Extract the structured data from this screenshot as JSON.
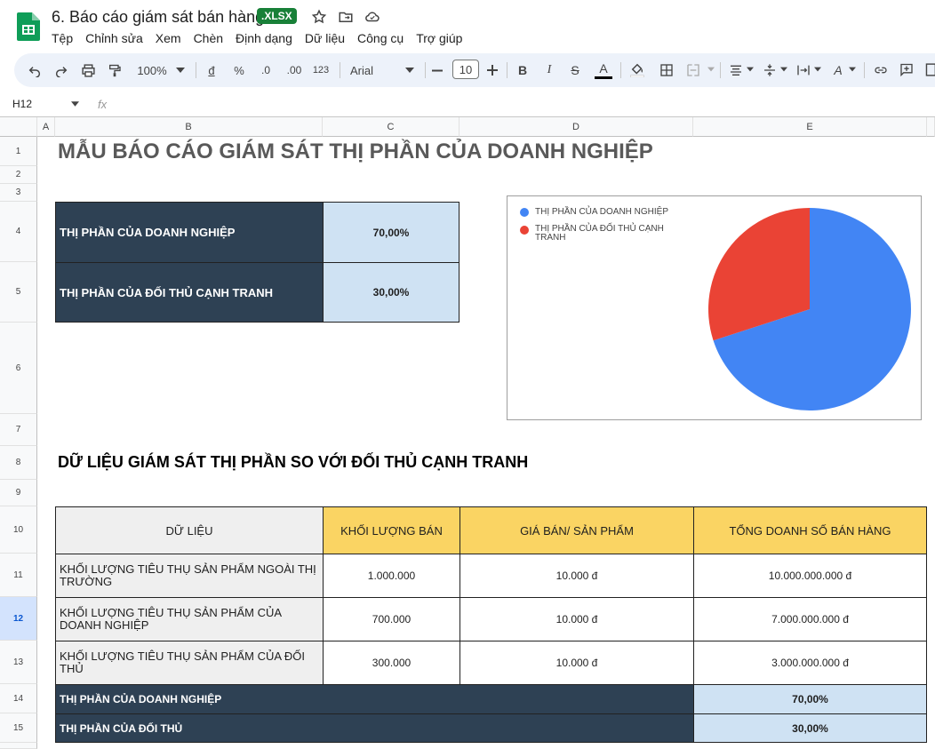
{
  "doc": {
    "title": "6. Báo cáo giám sát bán hàng",
    "badge": ".XLSX"
  },
  "menu": [
    "Tệp",
    "Chỉnh sửa",
    "Xem",
    "Chèn",
    "Định dạng",
    "Dữ liệu",
    "Công cụ",
    "Trợ giúp"
  ],
  "toolbar": {
    "zoom": "100%",
    "font": "Arial",
    "font_size": "10",
    "currency": "đ",
    "percent": "%",
    "dec_less": ".0",
    "dec_more": ".00",
    "num_format": "123"
  },
  "formula": {
    "cell_ref": "H12",
    "fx": "fx"
  },
  "columns": [
    "A",
    "B",
    "C",
    "D",
    "E"
  ],
  "rows": [
    "1",
    "2",
    "3",
    "4",
    "5",
    "6",
    "7",
    "8",
    "9",
    "10",
    "11",
    "12",
    "13",
    "14",
    "15"
  ],
  "sheet": {
    "title": "MẪU BÁO CÁO GIÁM SÁT THỊ PHẦN CỦA DOANH NGHIỆP",
    "summary": [
      {
        "label": "THỊ PHẦN CỦA DOANH NGHIỆP",
        "value": "70,00%"
      },
      {
        "label": "THỊ PHẦN CỦA ĐỐI THỦ CẠNH TRANH",
        "value": "30,00%"
      }
    ],
    "section_title": "DỮ LIỆU GIÁM SÁT THỊ PHẦN SO VỚI ĐỐI THỦ CẠNH TRANH",
    "table_headers": [
      "DỮ LIỆU",
      "KHỐI LƯỢNG BÁN",
      "GIÁ BÁN/ SẢN PHẨM",
      "TỔNG DOANH SỐ BÁN HÀNG"
    ],
    "table_rows": [
      [
        "KHỐI LƯỢNG TIÊU THỤ SẢN PHẨM NGOÀI THỊ TRƯỜNG",
        "1.000.000",
        "10.000 đ",
        "10.000.000.000 đ"
      ],
      [
        "KHỐI LƯỢNG TIÊU THỤ SẢN PHẨM CỦA DOANH NGHIỆP",
        "700.000",
        "10.000 đ",
        "7.000.000.000 đ"
      ],
      [
        "KHỐI LƯỢNG TIÊU THỤ SẢN PHẨM CỦA ĐỐI THỦ",
        "300.000",
        "10.000 đ",
        "3.000.000.000 đ"
      ]
    ],
    "footer_rows": [
      {
        "label": "THỊ PHẦN CỦA DOANH NGHIỆP",
        "value": "70,00%"
      },
      {
        "label": "THỊ PHẦN CỦA ĐỐI THỦ",
        "value": "30,00%"
      }
    ]
  },
  "chart_data": {
    "type": "pie",
    "categories": [
      "THỊ PHẦN CỦA DOANH NGHIỆP",
      "THỊ PHẦN CỦA ĐỐI THỦ CẠNH TRANH"
    ],
    "values": [
      70,
      30
    ],
    "colors": [
      "#4285f4",
      "#ea4335"
    ],
    "legend": "top-left"
  }
}
